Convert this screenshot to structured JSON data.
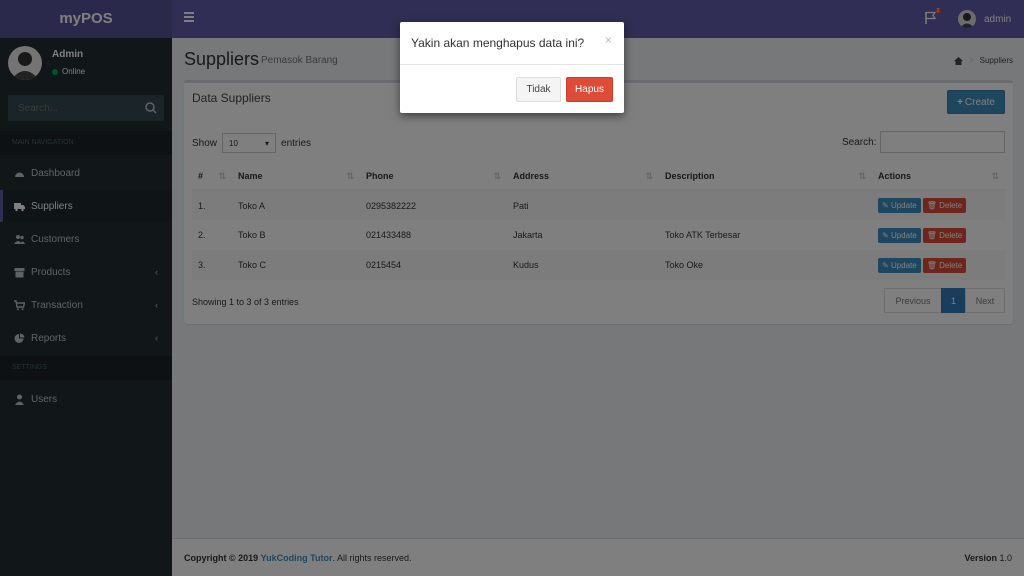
{
  "app": {
    "name": "myPOS"
  },
  "header": {
    "user_name": "admin",
    "flag_count": "2"
  },
  "sidebar": {
    "user": {
      "name": "Admin",
      "status": "Online"
    },
    "search_placeholder": "Search...",
    "sections": [
      "MAIN NAVIGATION",
      "SETTINGS"
    ],
    "items": [
      {
        "label": "Dashboard",
        "icon": "dashboard-icon"
      },
      {
        "label": "Suppliers",
        "icon": "truck-icon"
      },
      {
        "label": "Customers",
        "icon": "users-icon"
      },
      {
        "label": "Products",
        "icon": "archive-icon"
      },
      {
        "label": "Transaction",
        "icon": "cart-icon"
      },
      {
        "label": "Reports",
        "icon": "pie-chart-icon"
      },
      {
        "label": "Users",
        "icon": "user-icon"
      }
    ]
  },
  "page": {
    "title": "Suppliers",
    "subtitle": "Pemasok Barang",
    "breadcrumb_current": "Suppliers"
  },
  "box": {
    "title": "Data Suppliers",
    "create_label": "Create",
    "show_label": "Show",
    "entries_value": "10",
    "entries_label": "entries",
    "search_label": "Search:",
    "columns": [
      "#",
      "Name",
      "Phone",
      "Address",
      "Description",
      "Actions"
    ],
    "rows": [
      {
        "no": "1.",
        "name": "Toko A",
        "phone": "0295382222",
        "address": "Pati",
        "description": ""
      },
      {
        "no": "2.",
        "name": "Toko B",
        "phone": "021433488",
        "address": "Jakarta",
        "description": "Toko ATK Terbesar"
      },
      {
        "no": "3.",
        "name": "Toko C",
        "phone": "0215454",
        "address": "Kudus",
        "description": "Toko Oke"
      }
    ],
    "update_label": "Update",
    "delete_label": "Delete",
    "info": "Showing 1 to 3 of 3 entries",
    "pager": {
      "prev": "Previous",
      "current": "1",
      "next": "Next"
    }
  },
  "footer": {
    "copyright": "Copyright © 2019",
    "brand": "YukCoding Tutor",
    "rights": ". All rights reserved.",
    "version_label": "Version",
    "version": "1.0"
  },
  "modal": {
    "title": "Yakin akan menghapus data ini?",
    "close": "×",
    "cancel_label": "Tidak",
    "confirm_label": "Hapus"
  }
}
